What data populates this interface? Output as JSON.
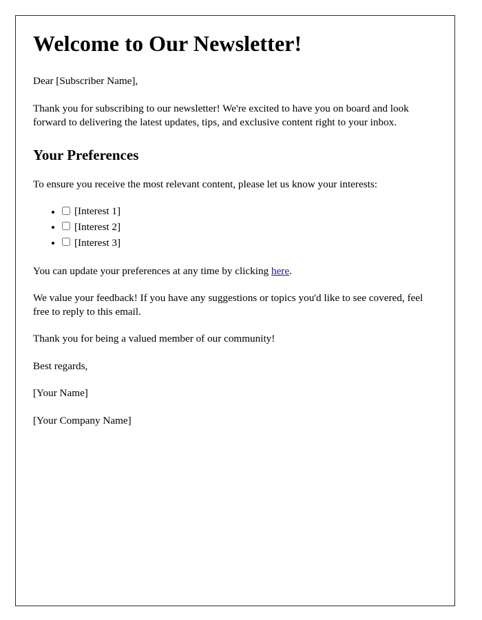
{
  "document": {
    "title": "Welcome to Our Newsletter!",
    "salutation": "Dear [Subscriber Name],",
    "intro_paragraph": "Thank you for subscribing to our newsletter! We're excited to have you on board and look forward to delivering the latest updates, tips, and exclusive content right to your inbox.",
    "preferences": {
      "heading": "Your Preferences",
      "instruction": "To ensure you receive the most relevant content, please let us know your interests:",
      "items": [
        {
          "label": "[Interest 1]",
          "checked": false
        },
        {
          "label": "[Interest 2]",
          "checked": false
        },
        {
          "label": "[Interest 3]",
          "checked": false
        }
      ]
    },
    "update_notice": {
      "before_link": "You can update your preferences at any time by clicking ",
      "link_text": "here",
      "after_link": "."
    },
    "feedback_paragraph": "We value your feedback! If you have any suggestions or topics you'd like to see covered, feel free to reply to this email.",
    "closing_thanks": "Thank you for being a valued member of our community!",
    "signoff": "Best regards,",
    "sender_name": "[Your Name]",
    "sender_company": "[Your Company Name]"
  },
  "colors": {
    "link": "#16168c",
    "text": "#000000",
    "page_border": "#2b2b2f",
    "background": "#ffffff"
  }
}
